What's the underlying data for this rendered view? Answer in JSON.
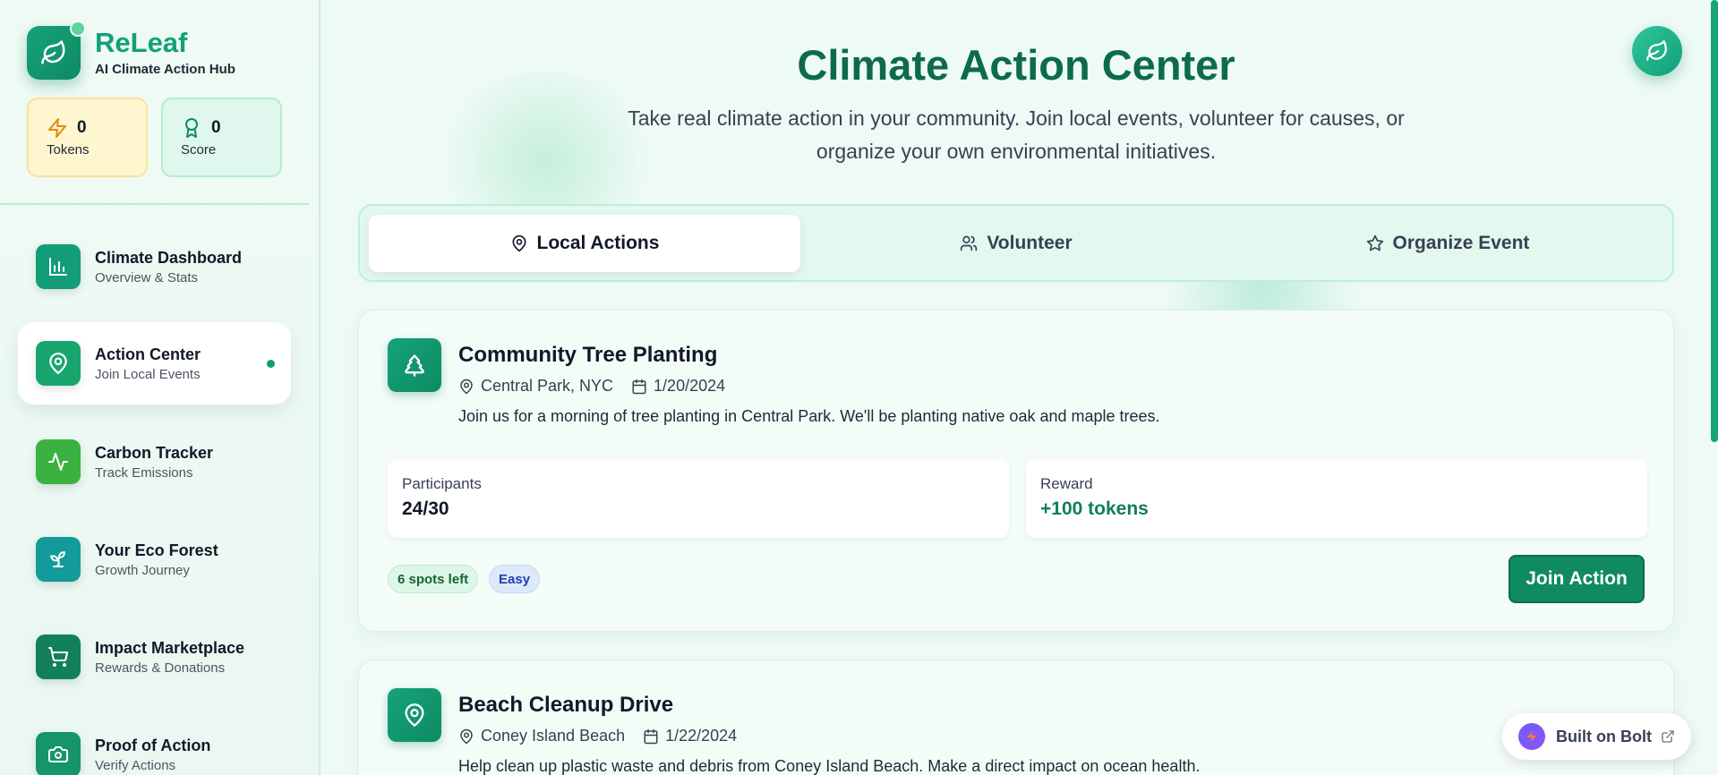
{
  "brand": {
    "name": "ReLeaf",
    "subtitle": "AI Climate Action Hub",
    "logo_icon": "leaf-icon"
  },
  "stats": {
    "tokens": {
      "value": "0",
      "label": "Tokens",
      "icon": "lightning-icon"
    },
    "score": {
      "value": "0",
      "label": "Score",
      "icon": "award-icon"
    }
  },
  "nav": {
    "items": [
      {
        "title": "Climate Dashboard",
        "subtitle": "Overview & Stats",
        "icon": "bar-chart-icon",
        "color": "#139c78"
      },
      {
        "title": "Action Center",
        "subtitle": "Join Local Events",
        "icon": "map-pin-icon",
        "color": "#18a66e",
        "active": true
      },
      {
        "title": "Carbon Tracker",
        "subtitle": "Track Emissions",
        "icon": "activity-icon",
        "color": "#3bb23f"
      },
      {
        "title": "Your Eco Forest",
        "subtitle": "Growth Journey",
        "icon": "sprout-icon",
        "color": "#129b98"
      },
      {
        "title": "Impact Marketplace",
        "subtitle": "Rewards & Donations",
        "icon": "cart-icon",
        "color": "#12805a"
      },
      {
        "title": "Proof of Action",
        "subtitle": "Verify Actions",
        "icon": "camera-icon",
        "color": "#16956a"
      }
    ]
  },
  "header": {
    "title": "Climate Action Center",
    "subtitle": "Take real climate action in your community. Join local events, volunteer for causes, or organize your own environmental initiatives."
  },
  "tabs": [
    {
      "label": "Local Actions",
      "icon": "map-pin-icon",
      "active": true
    },
    {
      "label": "Volunteer",
      "icon": "users-icon"
    },
    {
      "label": "Organize Event",
      "icon": "star-icon"
    }
  ],
  "actions": [
    {
      "title": "Community Tree Planting",
      "location": "Central Park, NYC",
      "date": "1/20/2024",
      "description": "Join us for a morning of tree planting in Central Park. We'll be planting native oak and maple trees.",
      "participants_label": "Participants",
      "participants": "24/30",
      "reward_label": "Reward",
      "reward": "+100 tokens",
      "spots": "6 spots left",
      "difficulty": "Easy",
      "button": "Join Action",
      "icon": "tree-icon"
    },
    {
      "title": "Beach Cleanup Drive",
      "location": "Coney Island Beach",
      "date": "1/22/2024",
      "description": "Help clean up plastic waste and debris from Coney Island Beach. Make a direct impact on ocean health.",
      "icon": "map-pin-icon"
    }
  ],
  "bolt": {
    "label": "Built on Bolt"
  },
  "colors": {
    "primary": "#0f8a62",
    "brand": "#12a07a",
    "title": "#0d6b4c"
  }
}
